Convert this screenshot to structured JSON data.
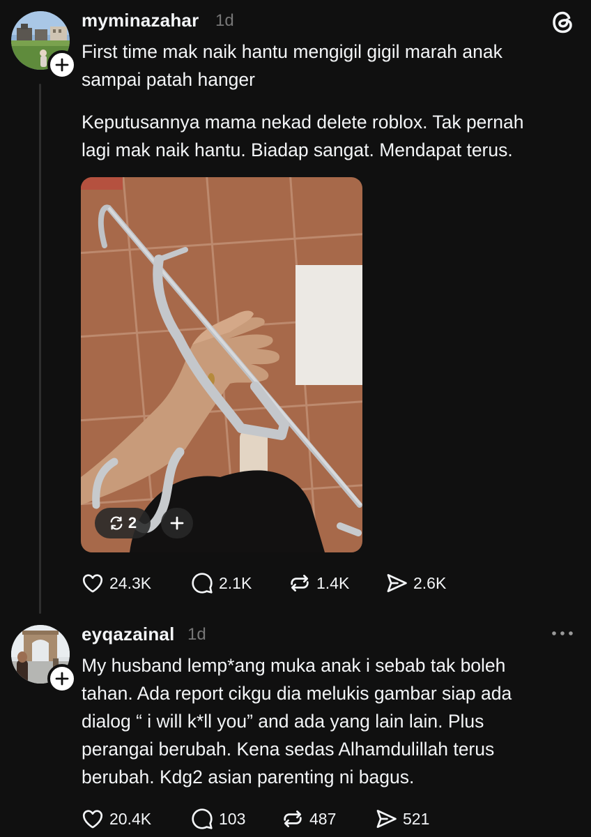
{
  "posts": [
    {
      "username": "myminazahar",
      "time": "1d",
      "paragraph_1": "First time mak naik hantu mengigil gigil marah anak\nsampai patah hanger",
      "paragraph_2": "Keputusannya mama nekad delete roblox. Tak pernah\nlagi mak naik hantu. Biadap sangat. Mendapat terus.",
      "media_repost_count": "2",
      "likes": "24.3K",
      "replies": "2.1K",
      "reposts": "1.4K",
      "shares": "2.6K"
    },
    {
      "username": "eyqazainal",
      "time": "1d",
      "paragraph_1": "My husband lemp*ang muka anak i sebab tak boleh\ntahan. Ada report cikgu dia melukis gambar siap ada\ndialog “ i will k*ll you” and ada yang lain lain. Plus\nperangai berubah. Kena sedas Alhamdulillah terus\nberubah. Kdg2 asian parenting ni bagus.",
      "likes": "20.4K",
      "replies": "103",
      "reposts": "487",
      "shares": "521"
    }
  ],
  "icons": {
    "app_logo": "threads-logo-icon",
    "like": "heart-icon",
    "reply": "comment-icon",
    "repost": "repost-icon",
    "share": "send-icon",
    "more": "more-horizontal-icon",
    "follow": "plus-icon"
  },
  "colors": {
    "background": "#101010",
    "text": "#f3f5f7",
    "secondary_text": "#777777",
    "thread_line": "#2e2e2e"
  }
}
